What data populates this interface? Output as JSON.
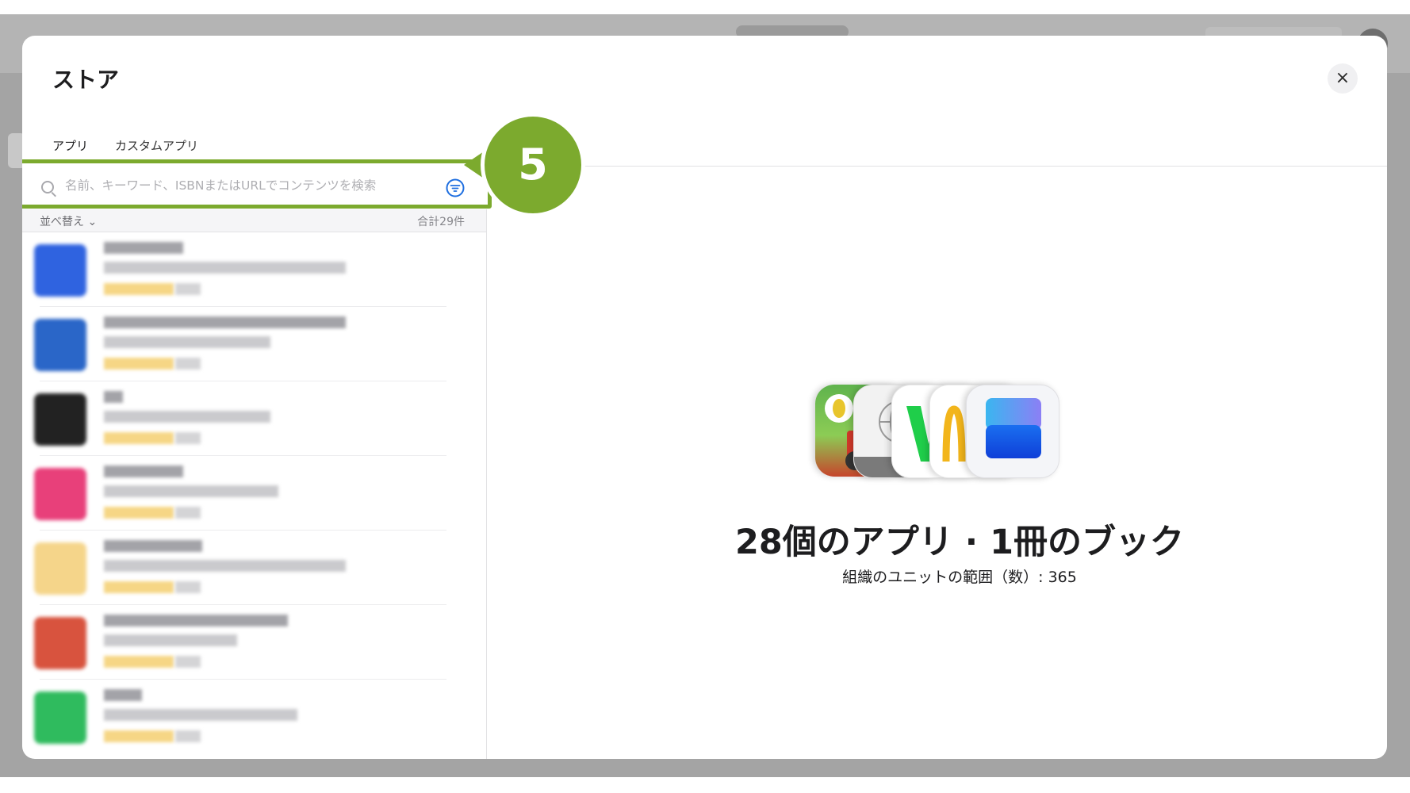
{
  "modal": {
    "title": "ストア",
    "close_glyph": "×"
  },
  "tabs": [
    {
      "label": "アプリ"
    },
    {
      "label": "カスタムアプリ"
    }
  ],
  "search": {
    "placeholder": "名前、キーワード、ISBNまたはURLでコンテンツを検索",
    "value": ""
  },
  "callout": {
    "number": "5",
    "color": "#7caa2e"
  },
  "list": {
    "sort_label": "並べ替え ⌄",
    "total_label": "合計29件",
    "items": [
      {
        "icon_color": "#2f63e0"
      },
      {
        "icon_color": "#2a66c8"
      },
      {
        "icon_color": "#222222"
      },
      {
        "icon_color": "#e8407a"
      },
      {
        "icon_color": "#f5d58a"
      },
      {
        "icon_color": "#d8533e"
      },
      {
        "icon_color": "#2fbb5e"
      }
    ]
  },
  "summary": {
    "title": "28個のアプリ · 1冊のブック",
    "subtitle": "組織のユニットの範囲（数）: 365"
  },
  "icons": [
    "search-icon",
    "filter-icon",
    "close-icon",
    "chevron-down-icon"
  ]
}
